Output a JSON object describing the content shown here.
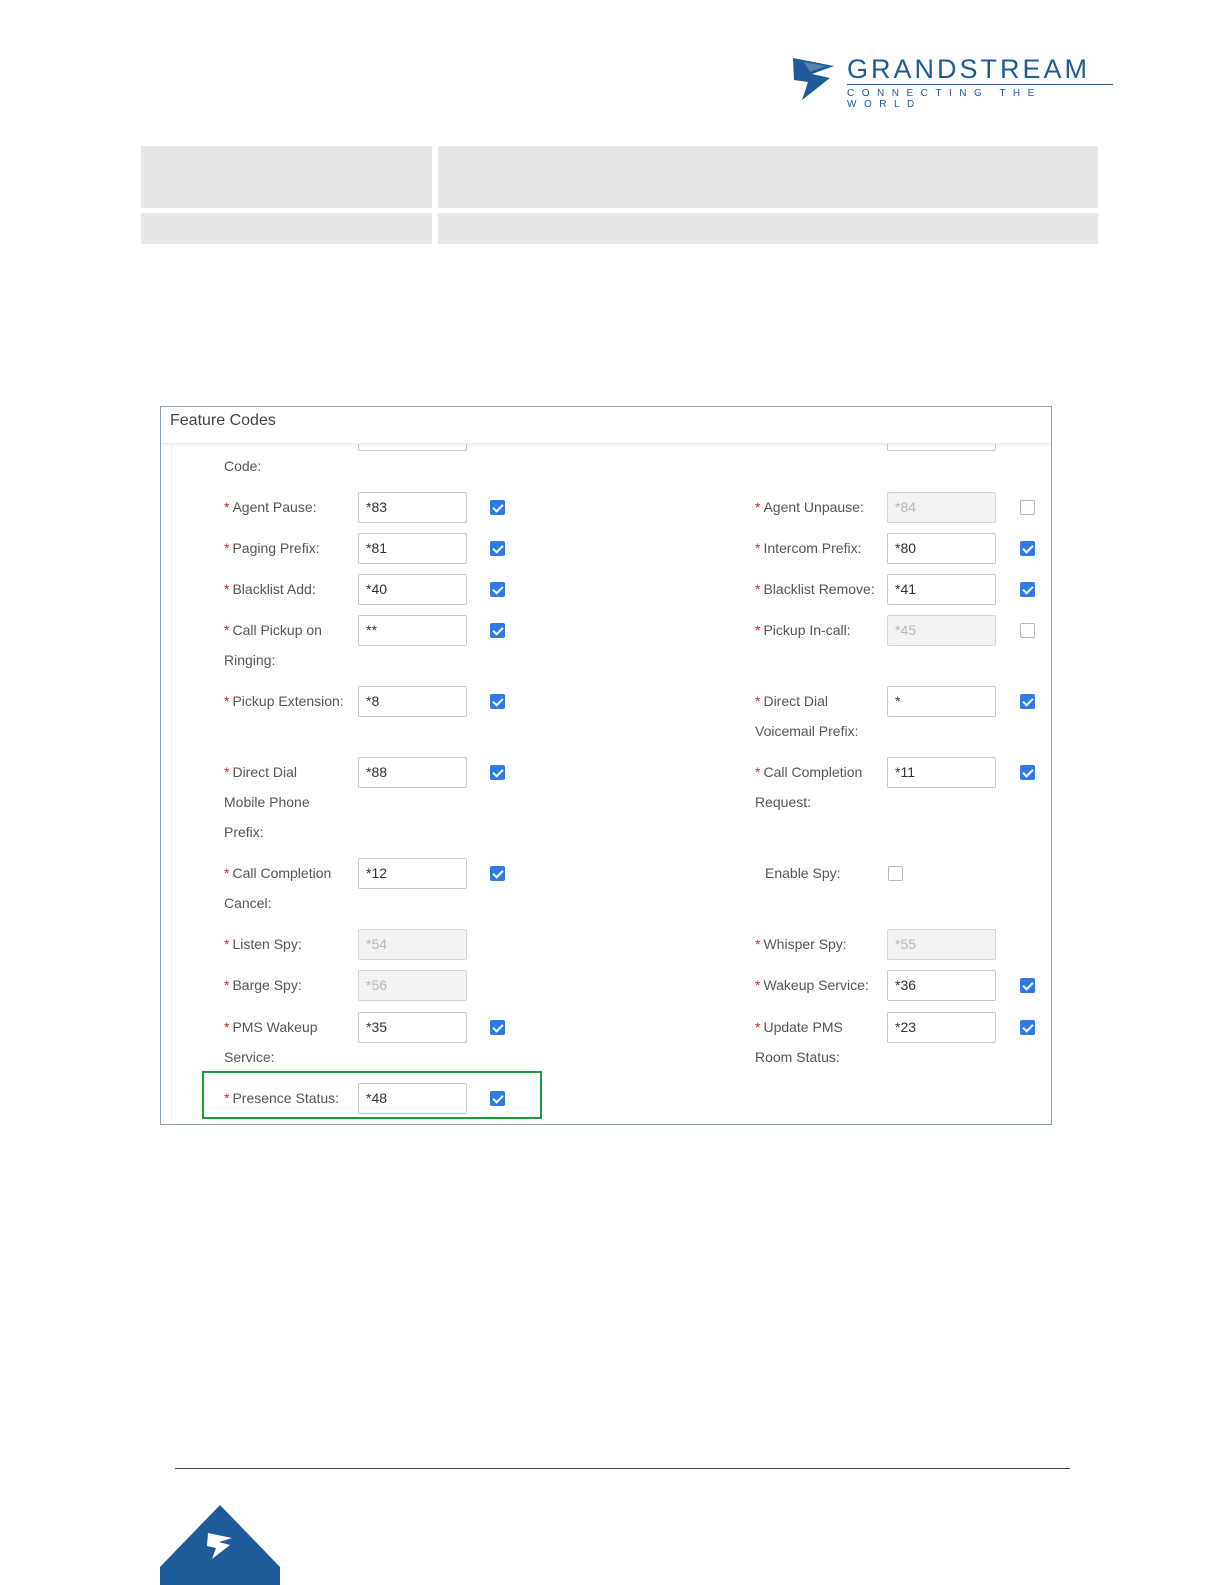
{
  "brand": {
    "name": "GRANDSTREAM",
    "tagline": "CONNECTING THE WORLD",
    "color": "#1f5a99"
  },
  "panel": {
    "title": "Feature Codes",
    "partial_label": "Code:"
  },
  "fields": [
    {
      "label": "Agent Pause:",
      "value": "*83",
      "disabled": false,
      "checked": true
    },
    {
      "label": "Agent Unpause:",
      "value": "*84",
      "disabled": true,
      "checked": false
    },
    {
      "label": "Paging Prefix:",
      "value": "*81",
      "disabled": false,
      "checked": true
    },
    {
      "label": "Intercom Prefix:",
      "value": "*80",
      "disabled": false,
      "checked": true
    },
    {
      "label": "Blacklist Add:",
      "value": "*40",
      "disabled": false,
      "checked": true
    },
    {
      "label": "Blacklist Remove:",
      "value": "*41",
      "disabled": false,
      "checked": true
    },
    {
      "label_lines": [
        "Call Pickup on",
        "Ringing:"
      ],
      "value": "**",
      "disabled": false,
      "checked": true
    },
    {
      "label": "Pickup In-call:",
      "value": "*45",
      "disabled": true,
      "checked": false
    },
    {
      "label": "Pickup Extension:",
      "value": "*8",
      "disabled": false,
      "checked": true
    },
    {
      "label_lines": [
        "Direct Dial",
        "Voicemail Prefix:"
      ],
      "value": "*",
      "disabled": false,
      "checked": true
    },
    {
      "label_lines": [
        "Direct Dial",
        "Mobile Phone",
        "Prefix:"
      ],
      "value": "*88",
      "disabled": false,
      "checked": true
    },
    {
      "label_lines": [
        "Call Completion",
        "Request:"
      ],
      "value": "*11",
      "disabled": false,
      "checked": true
    },
    {
      "label_lines": [
        "Call Completion",
        "Cancel:"
      ],
      "value": "*12",
      "disabled": false,
      "checked": true
    },
    {
      "label": "Enable Spy:",
      "checked": false
    },
    {
      "label": "Listen Spy:",
      "value": "*54",
      "disabled": true
    },
    {
      "label": "Whisper Spy:",
      "value": "*55",
      "disabled": true
    },
    {
      "label": "Barge Spy:",
      "value": "*56",
      "disabled": true
    },
    {
      "label": "Wakeup Service:",
      "value": "*36",
      "disabled": false,
      "checked": true
    },
    {
      "label_lines": [
        "PMS Wakeup",
        "Service:"
      ],
      "value": "*35",
      "disabled": false,
      "checked": true
    },
    {
      "label_lines": [
        "Update PMS",
        "Room Status:"
      ],
      "value": "*23",
      "disabled": false,
      "checked": true
    },
    {
      "label": "Presence Status:",
      "value": "*48",
      "disabled": false,
      "checked": true
    }
  ],
  "colors": {
    "checkbox_on": "#2f7ae5",
    "required_mark": "#d9261c",
    "highlight": "#1f9b3b"
  }
}
